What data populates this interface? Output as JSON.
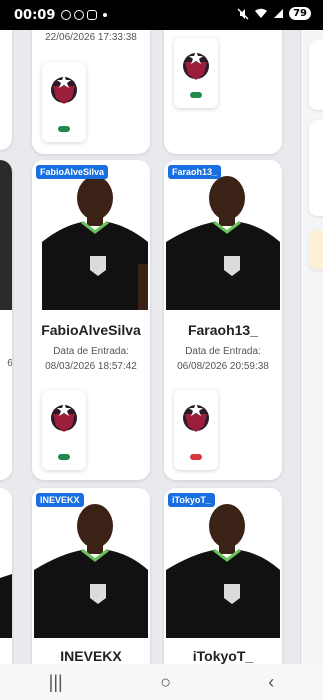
{
  "status_bar": {
    "time": "00:09",
    "battery": "79"
  },
  "top_row": {
    "left_date": "22/06/2026 17:33:38"
  },
  "cards": [
    {
      "tag": "FabioAlveSilva",
      "name": "FabioAlveSilva",
      "entry_label": "Data de Entrada:",
      "entry_date": "08/03/2026 18:57:42",
      "status_color": "#1f8a4c"
    },
    {
      "tag": "Faraoh13_",
      "name": "Faraoh13_",
      "entry_label": "Data de Entrada:",
      "entry_date": "06/08/2026 20:59:38",
      "status_color": "#d9363e"
    },
    {
      "tag": "INEVEKX",
      "name": "INEVEKX"
    },
    {
      "tag": "iTokyoT_",
      "name": "iTokyoT_"
    }
  ],
  "left_partial": {
    "digit": "6"
  },
  "colors": {
    "tag_bg": "#1a6fe0",
    "green": "#1f8a4c",
    "red": "#d9363e",
    "jersey": "#111111",
    "crest": "#9b1e3a"
  },
  "nav": {
    "recent": "|||",
    "home": "○",
    "back": "‹"
  }
}
